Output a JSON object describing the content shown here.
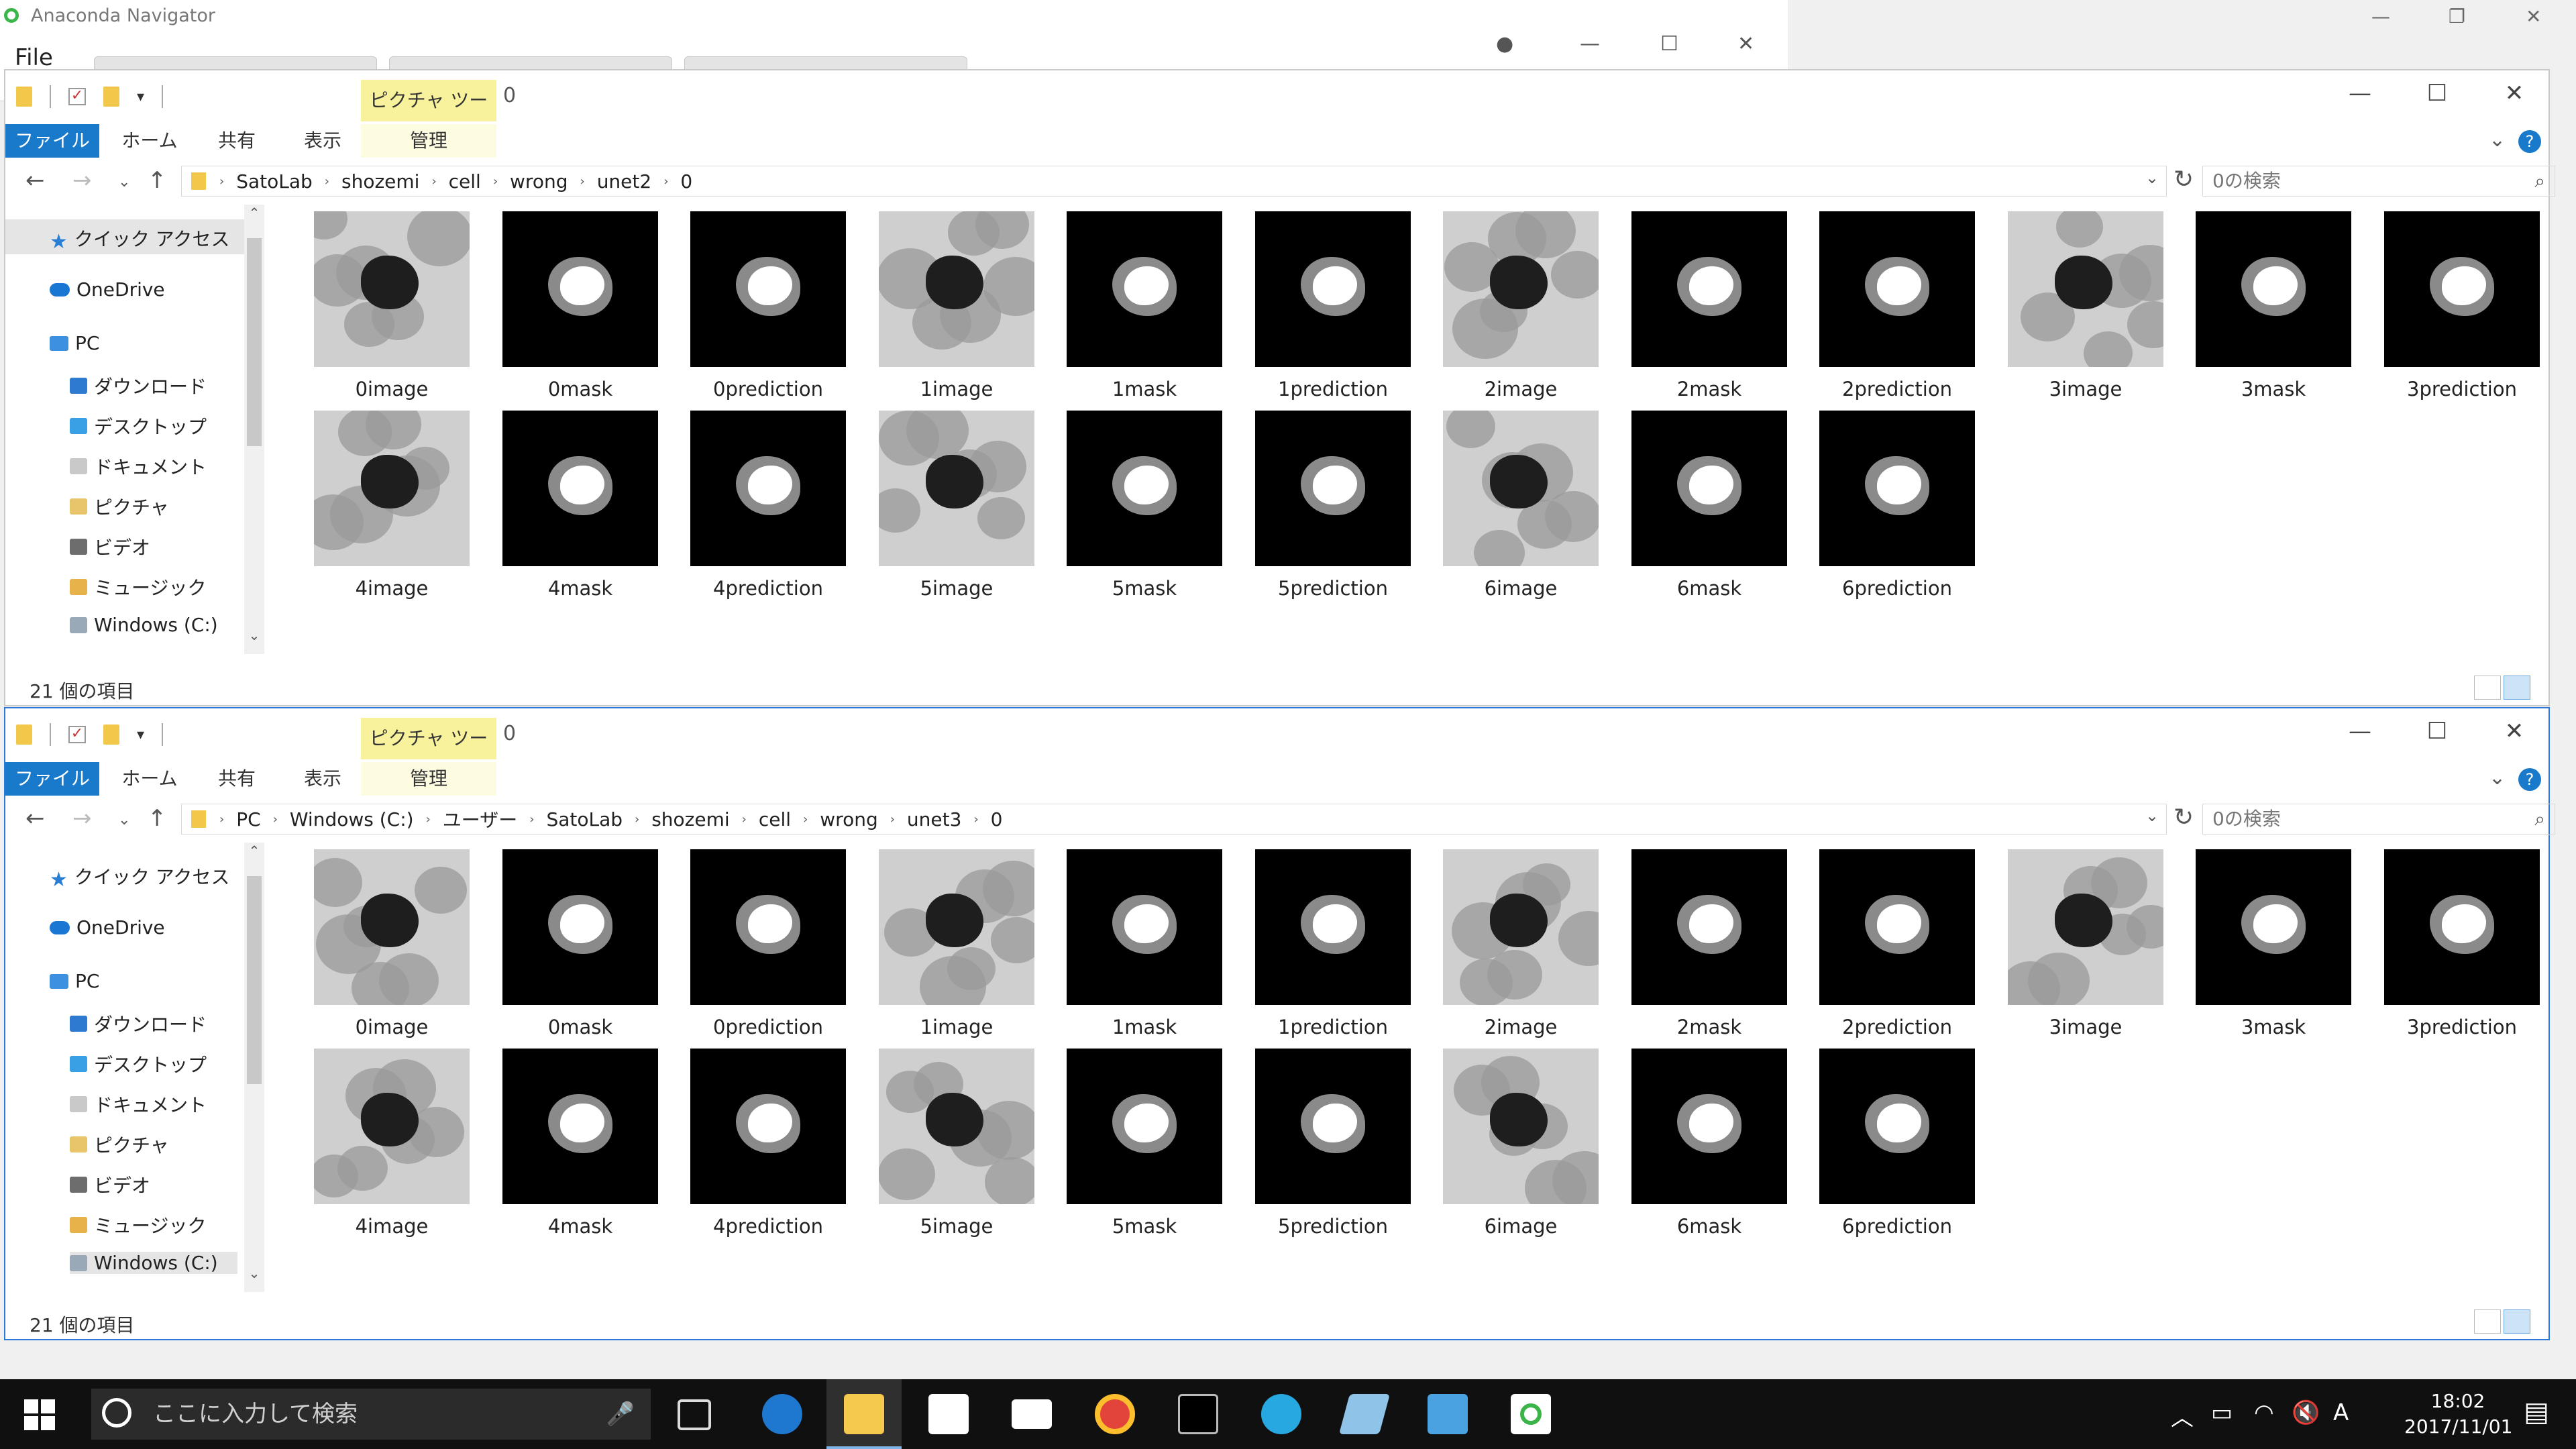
{
  "anaconda": {
    "title": "Anaconda Navigator",
    "menu_file": "File"
  },
  "window1": {
    "picture_tools": "ピクチャ ツール",
    "title": "0",
    "ribbon": {
      "file": "ファイル",
      "home": "ホーム",
      "share": "共有",
      "view": "表示",
      "manage": "管理"
    },
    "breadcrumb": [
      "SatoLab",
      "shozemi",
      "cell",
      "wrong",
      "unet2",
      "0"
    ],
    "search_placeholder": "0の検索",
    "nav": {
      "quick_access": "クイック アクセス",
      "onedrive": "OneDrive",
      "pc": "PC",
      "downloads": "ダウンロード",
      "desktop": "デスクトップ",
      "documents": "ドキュメント",
      "pictures": "ピクチャ",
      "videos": "ビデオ",
      "music": "ミュージック",
      "windows_c": "Windows (C:)"
    },
    "files": [
      "0image",
      "0mask",
      "0prediction",
      "1image",
      "1mask",
      "1prediction",
      "2image",
      "2mask",
      "2prediction",
      "3image",
      "3mask",
      "3prediction",
      "4image",
      "4mask",
      "4prediction",
      "5image",
      "5mask",
      "5prediction",
      "6image",
      "6mask",
      "6prediction"
    ],
    "status": "21 個の項目"
  },
  "window2": {
    "picture_tools": "ピクチャ ツール",
    "title": "0",
    "ribbon": {
      "file": "ファイル",
      "home": "ホーム",
      "share": "共有",
      "view": "表示",
      "manage": "管理"
    },
    "breadcrumb": [
      "PC",
      "Windows (C:)",
      "ユーザー",
      "SatoLab",
      "shozemi",
      "cell",
      "wrong",
      "unet3",
      "0"
    ],
    "search_placeholder": "0の検索",
    "nav": {
      "quick_access": "クイック アクセス",
      "onedrive": "OneDrive",
      "pc": "PC",
      "downloads": "ダウンロード",
      "desktop": "デスクトップ",
      "documents": "ドキュメント",
      "pictures": "ピクチャ",
      "videos": "ビデオ",
      "music": "ミュージック",
      "windows_c": "Windows (C:)"
    },
    "files": [
      "0image",
      "0mask",
      "0prediction",
      "1image",
      "1mask",
      "1prediction",
      "2image",
      "2mask",
      "2prediction",
      "3image",
      "3mask",
      "3prediction",
      "4image",
      "4mask",
      "4prediction",
      "5image",
      "5mask",
      "5prediction",
      "6image",
      "6mask",
      "6prediction"
    ],
    "status": "21 個の項目"
  },
  "taskbar": {
    "search_placeholder": "ここに入力して検索",
    "time": "18:02",
    "date": "2017/11/01",
    "ime": "A",
    "apps": [
      "task-view-icon",
      "edge-icon",
      "file-explorer-icon",
      "store-icon",
      "mail-icon",
      "chrome-icon",
      "terminal-icon",
      "docker-icon",
      "notepad-icon",
      "photos-icon",
      "anaconda-icon"
    ]
  },
  "colors": {
    "accent": "#1979ca",
    "picture_tools_bg": "#f7f29b",
    "taskbar": "#101010"
  }
}
